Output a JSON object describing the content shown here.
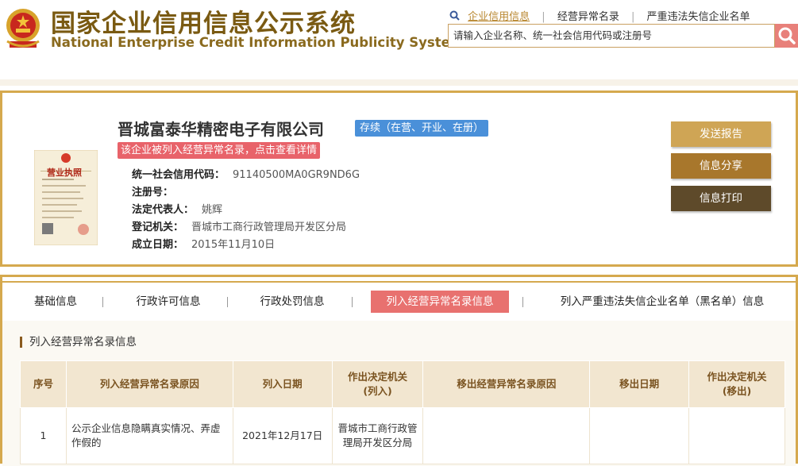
{
  "header": {
    "title_cn": "国家企业信用信息公示系统",
    "title_en": "National Enterprise Credit Information Publicity System",
    "links": [
      "企业信用信息",
      "经营异常名录",
      "严重违法失信企业名单"
    ],
    "search_placeholder": "请输入企业名称、统一社会信用代码或注册号",
    "search_icon": "search-icon"
  },
  "company": {
    "name": "晋城富泰华精密电子有限公司",
    "status": "存续（在营、开业、在册）",
    "warning": "该企业被列入经营异常名录，点击查看详情",
    "license_title": "营业执照",
    "fields": [
      {
        "label": "统一社会信用代码：",
        "value": "91140500MA0GR9ND6G"
      },
      {
        "label": "注册号：",
        "value": ""
      },
      {
        "label": "法定代表人：",
        "value": "姚辉"
      },
      {
        "label": "登记机关：",
        "value": "晋城市工商行政管理局开发区分局"
      },
      {
        "label": "成立日期：",
        "value": "2015年11月10日"
      }
    ],
    "buttons": [
      "发送报告",
      "信息分享",
      "信息打印"
    ]
  },
  "tabs": [
    "基础信息",
    "行政许可信息",
    "行政处罚信息",
    "列入经营异常名录信息",
    "列入严重违法失信企业名单（黑名单）信息"
  ],
  "active_tab_index": 3,
  "section": {
    "title": "列入经营异常名录信息",
    "table": {
      "headers": [
        [
          "序号"
        ],
        [
          "列入经营异常名录原因"
        ],
        [
          "列入日期"
        ],
        [
          "作出决定机关",
          "(列入)"
        ],
        [
          "移出经营异常名录原因"
        ],
        [
          "移出日期"
        ],
        [
          "作出决定机关",
          "(移出)"
        ]
      ],
      "rows": [
        {
          "index": "1",
          "reason_in": "公示企业信息隐瞒真实情况、弄虚作假的",
          "date_in": "2021年12月17日",
          "authority_in": "晋城市工商行政管理局开发区分局",
          "reason_out": "",
          "date_out": "",
          "authority_out": ""
        }
      ]
    }
  },
  "colors": {
    "gold_border": "#d5a94e",
    "active_tab": "#e8716f",
    "status_blue": "#4a90d9",
    "warning_red": "#e8636a"
  }
}
